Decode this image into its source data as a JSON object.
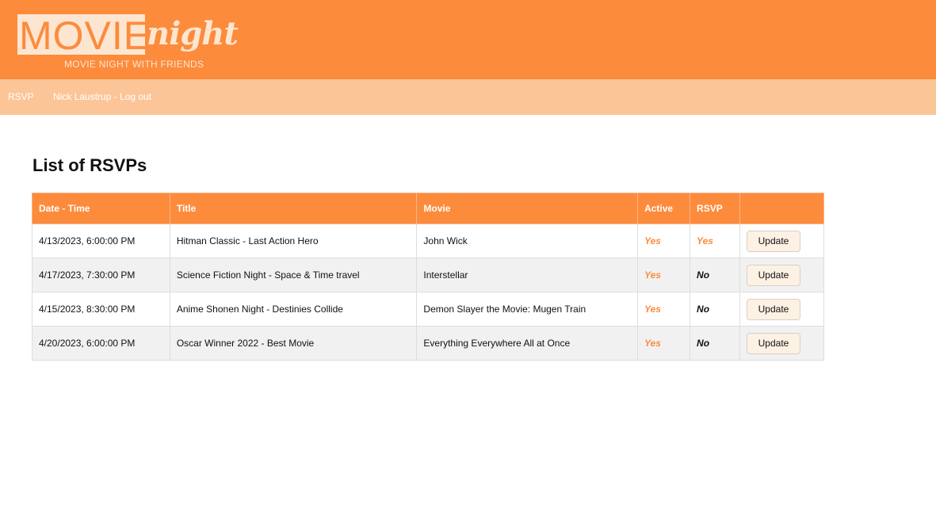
{
  "brand": {
    "logo_word1": "MOVIE",
    "logo_word2": "night",
    "tagline": "MOVIE NIGHT WITH FRIENDS"
  },
  "nav": {
    "rsvp": "RSVP",
    "user_logout": "Nick Laustrup - Log out"
  },
  "page_title": "List of RSVPs",
  "table": {
    "headers": [
      "Date - Time",
      "Title",
      "Movie",
      "Active",
      "RSVP",
      ""
    ],
    "rows": [
      {
        "datetime": "4/13/2023, 6:00:00 PM",
        "title": "Hitman Classic - Last Action Hero",
        "movie": "John Wick",
        "active": "Yes",
        "rsvp": "Yes",
        "action": "Update"
      },
      {
        "datetime": "4/17/2023, 7:30:00 PM",
        "title": "Science Fiction Night - Space & Time travel",
        "movie": "Interstellar",
        "active": "Yes",
        "rsvp": "No",
        "action": "Update"
      },
      {
        "datetime": "4/15/2023, 8:30:00 PM",
        "title": "Anime Shonen Night - Destinies Collide",
        "movie": "Demon Slayer the Movie: Mugen Train",
        "active": "Yes",
        "rsvp": "No",
        "action": "Update"
      },
      {
        "datetime": "4/20/2023, 6:00:00 PM",
        "title": "Oscar Winner 2022 - Best Movie",
        "movie": "Everything Everywhere All at Once",
        "active": "Yes",
        "rsvp": "No",
        "action": "Update"
      }
    ]
  },
  "colors": {
    "header_bg": "#fd8b3c",
    "nav_bg": "#fcc597",
    "accent": "#fd8b3c"
  }
}
